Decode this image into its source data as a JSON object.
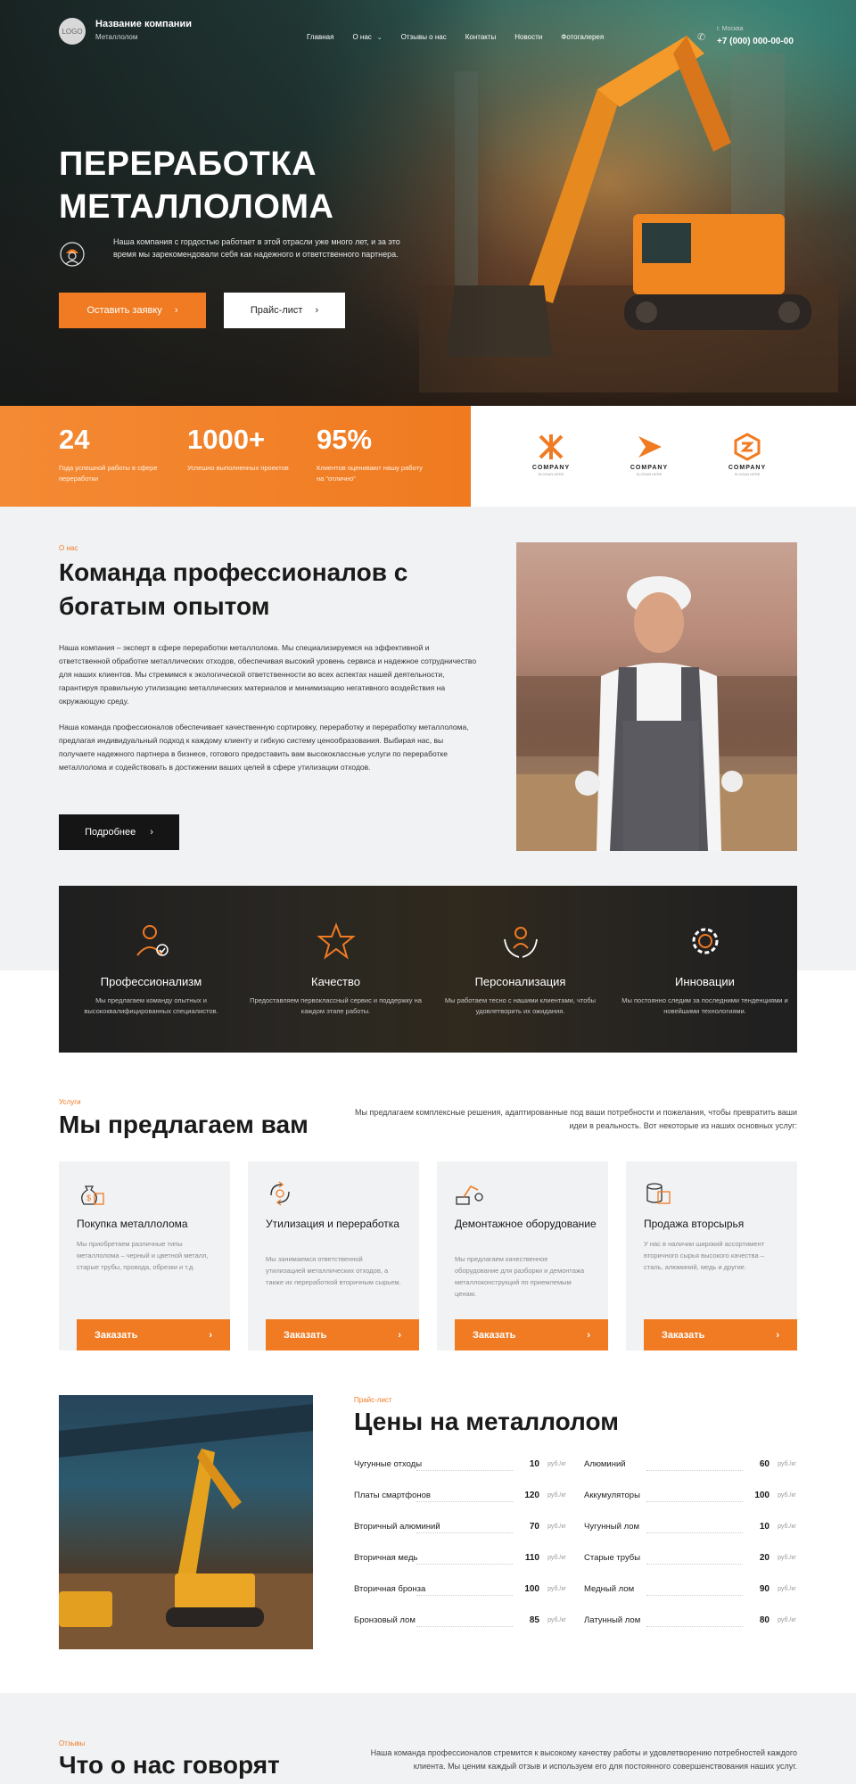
{
  "header": {
    "logo_text": "LOGO",
    "company_name": "Название компании",
    "company_sub": "Металлолом",
    "nav": [
      "Главная",
      "О нас",
      "Отзывы о нас",
      "Контакты",
      "Новости",
      "Фотогалерея"
    ],
    "city": "г. Москва",
    "phone": "+7 (000) 000-00-00"
  },
  "hero": {
    "title_line1": "ПЕРЕРАБОТКА",
    "title_line2": "МЕТАЛЛОЛОМА",
    "description": "Наша компания с гордостью работает в этой отрасли уже много лет, и за это время мы зарекомендовали себя как надежного и ответственного партнера.",
    "primary_button": "Оставить заявку",
    "secondary_button": "Прайс-лист"
  },
  "stats": [
    {
      "value": "24",
      "label": "Года успешной работы в сфере переработки"
    },
    {
      "value": "1000+",
      "label": "Успешно выполненных проектов"
    },
    {
      "value": "95%",
      "label": "Клиентов оценивают нашу работу на \"отлично\""
    }
  ],
  "partners": [
    {
      "name": "COMPANY",
      "sub": "SLOGAN HERE"
    },
    {
      "name": "COMPANY",
      "sub": "SLOGAN HERE"
    },
    {
      "name": "COMPANY",
      "sub": "SLOGAN HERE"
    }
  ],
  "about": {
    "tag": "О нас",
    "title": "Команда профессионалов с богатым опытом",
    "p1": "Наша компания – эксперт в сфере переработки металлолома. Мы специализируемся на эффективной и ответственной обработке металлических отходов, обеспечивая высокий уровень сервиса и надежное сотрудничество для наших клиентов. Мы стремимся к экологической ответственности во всех аспектах нашей деятельности, гарантируя правильную утилизацию металлических материалов и минимизацию негативного воздействия на окружающую среду.",
    "p2": "Наша команда профессионалов обеспечивает качественную сортировку, переработку и переработку металлолома, предлагая индивидуальный подход к каждому клиенту и гибкую систему ценообразования. Выбирая нас, вы получаете надежного партнера в бизнесе, готового предоставить вам высококлассные услуги по переработке металлолома и содействовать в достижении ваших целей в сфере утилизации отходов.",
    "button": "Подробнее"
  },
  "values": [
    {
      "title": "Профессионализм",
      "text": "Мы предлагаем команду опытных и высококвалифицированных специалистов.",
      "icon": "worker-check-icon"
    },
    {
      "title": "Качество",
      "text": "Предоставляем первоклассный сервис и поддержку на каждом этапе работы.",
      "icon": "star-icon"
    },
    {
      "title": "Персонализация",
      "text": "Мы работаем тесно с нашими клиентами, чтобы удовлетворить их ожидания.",
      "icon": "hands-person-icon"
    },
    {
      "title": "Инновации",
      "text": "Мы постоянно следим за последними тенденциями и новейшими технологиями.",
      "icon": "gear-icon"
    }
  ],
  "services": {
    "tag": "Услуги",
    "title": "Мы предлагаем вам",
    "lead": "Мы предлагаем комплексные решения, адаптированные под ваши потребности и пожелания, чтобы превратить ваши идеи в реальность. Вот некоторые из наших основных услуг:",
    "cards": [
      {
        "title": "Покупка металлолома",
        "text": "Мы приобретаем различные типы металлолома – черный и цветной металл, старые трубы, провода, обрезки и т.д.",
        "button": "Заказать",
        "icon": "money-bag-icon"
      },
      {
        "title": "Утилизация и переработка",
        "text": "Мы занимаемся ответственной утилизацией металлических отходов, а также их переработкой вторичным сырьем.",
        "button": "Заказать",
        "icon": "recycle-icon"
      },
      {
        "title": "Демонтажное оборудование",
        "text": "Мы предлагаем качественное оборудование для разборки и демонтажа металлоконструкций по приемлемым ценам.",
        "button": "Заказать",
        "icon": "crane-icon"
      },
      {
        "title": "Продажа вторсырья",
        "text": "У нас в наличии широкий ассортимент вторичного сырья высокого качества – сталь, алюминий, медь и другие.",
        "button": "Заказать",
        "icon": "materials-box-icon"
      }
    ]
  },
  "prices": {
    "tag": "Прайс-лист",
    "title": "Цены на металлолом",
    "unit": "руб./кг",
    "left": [
      {
        "name": "Чугунные отходы",
        "price": "10"
      },
      {
        "name": "Платы смартфонов",
        "price": "120"
      },
      {
        "name": "Вторичный алюминий",
        "price": "70"
      },
      {
        "name": "Вторичная медь",
        "price": "110"
      },
      {
        "name": "Вторичная бронза",
        "price": "100"
      },
      {
        "name": "Бронзовый лом",
        "price": "85"
      }
    ],
    "right": [
      {
        "name": "Алюминий",
        "price": "60"
      },
      {
        "name": "Аккумуляторы",
        "price": "100"
      },
      {
        "name": "Чугунный лом",
        "price": "10"
      },
      {
        "name": "Старые трубы",
        "price": "20"
      },
      {
        "name": "Медный лом",
        "price": "90"
      },
      {
        "name": "Латунный лом",
        "price": "80"
      }
    ]
  },
  "reviews": {
    "tag": "Отзывы",
    "title": "Что о нас говорят",
    "lead": "Наша команда профессионалов стремится к высокому качеству работы и удовлетворению потребностей каждого клиента. Мы ценим каждый отзыв и используем его для постоянного совершенствования наших услуг."
  },
  "colors": {
    "accent": "#f07b23",
    "dark": "#151515",
    "light_bg": "#f1f2f3"
  }
}
